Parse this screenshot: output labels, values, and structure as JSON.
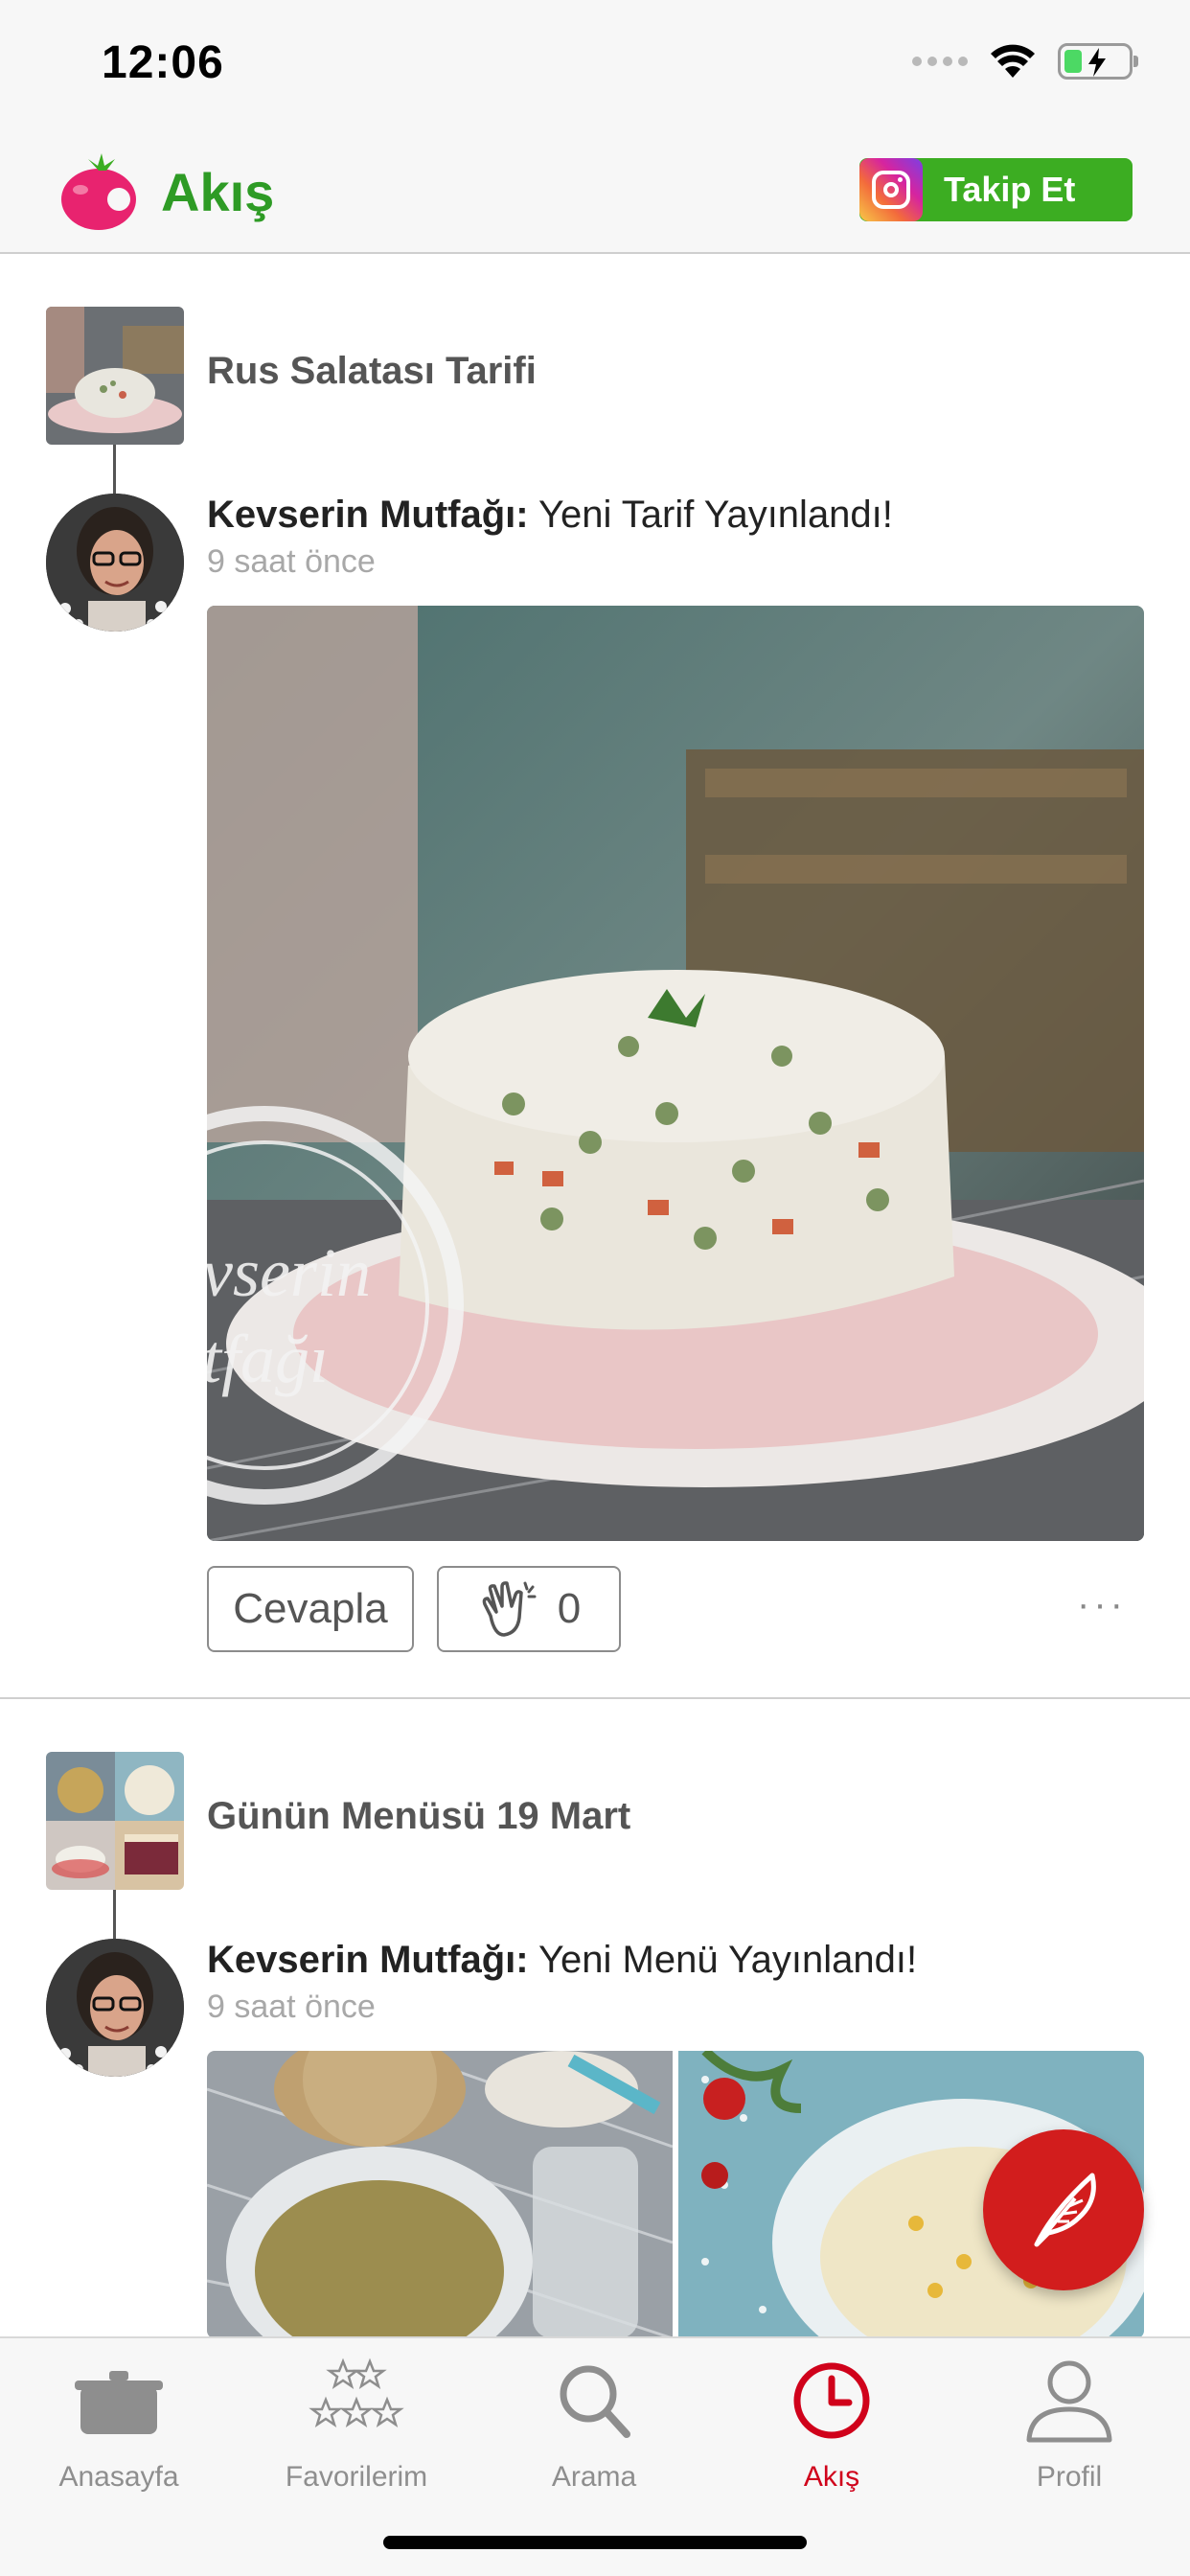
{
  "status_bar": {
    "time": "12:06"
  },
  "header": {
    "title": "Akış",
    "follow_label": "Takip Et"
  },
  "feed": [
    {
      "recipe_title": "Rus Salatası Tarifi",
      "author": "Kevserin Mutfağı:",
      "action_text": "Yeni Tarif Yayınlandı!",
      "time_ago": "9 saat önce",
      "image_watermark": [
        "vserin",
        "tfağı"
      ],
      "reply_label": "Cevapla",
      "clap_count": "0",
      "more_label": "···"
    },
    {
      "recipe_title": "Günün Menüsü 19 Mart",
      "author": "Kevserin Mutfağı:",
      "action_text": "Yeni Menü Yayınlandı!",
      "time_ago": "9 saat önce"
    }
  ],
  "tabs": [
    {
      "label": "Anasayfa",
      "icon": "pot-icon",
      "active": false
    },
    {
      "label": "Favorilerim",
      "icon": "stars-icon",
      "active": false
    },
    {
      "label": "Arama",
      "icon": "search-icon",
      "active": false
    },
    {
      "label": "Akış",
      "icon": "clock-icon",
      "active": true
    },
    {
      "label": "Profil",
      "icon": "profile-icon",
      "active": false
    }
  ],
  "colors": {
    "brand_green": "#2e9b25",
    "follow_green": "#3cad22",
    "active_red": "#d0021b",
    "fab_red": "#d21d1d"
  }
}
